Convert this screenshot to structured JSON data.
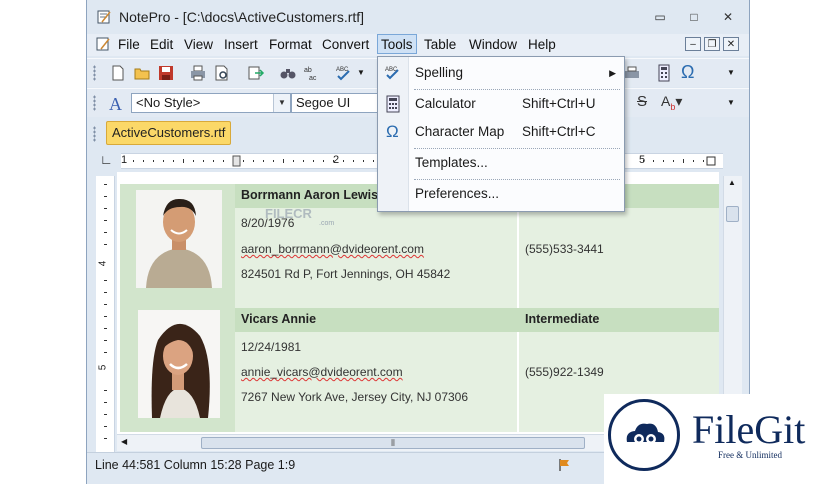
{
  "window": {
    "title": "NotePro - [C:\\docs\\ActiveCustomers.rtf]",
    "minimize_glyph": "▭",
    "maximize_glyph": "□",
    "close_glyph": "✕"
  },
  "menubar": {
    "items": [
      "File",
      "Edit",
      "View",
      "Insert",
      "Format",
      "Convert",
      "Tools",
      "Table",
      "Window",
      "Help"
    ],
    "active": "Tools"
  },
  "format_toolbar": {
    "style_value": "<No Style>",
    "font_value": "Segoe UI"
  },
  "document_tab": "ActiveCustomers.rtf",
  "ruler": {
    "marks": [
      "1",
      "2",
      "5"
    ]
  },
  "vruler": {
    "marks": [
      "4",
      "5"
    ]
  },
  "records": [
    {
      "name": "Borrmann Aaron Lewis",
      "level": "",
      "date": "8/20/1976",
      "email": "aaron_borrmann@dvideorent.com",
      "phone": "(555)533-3441",
      "address": "824501 Rd P, Fort Jennings, OH 45842"
    },
    {
      "name": "Vicars Annie",
      "level": "Intermediate",
      "date": "12/24/1981",
      "email": "annie_vicars@dvideorent.com",
      "phone": "(555)922-1349",
      "address": "7267 New York Ave, Jersey City, NJ 07306"
    }
  ],
  "tools_menu": {
    "items": [
      {
        "label": "Spelling",
        "shortcut": "",
        "icon": "spelling-icon",
        "submenu": true
      },
      {
        "label": "Calculator",
        "shortcut": "Shift+Ctrl+U",
        "icon": "calculator-icon"
      },
      {
        "label": "Character Map",
        "shortcut": "Shift+Ctrl+C",
        "icon": "omega-icon"
      },
      {
        "label": "Templates...",
        "shortcut": "",
        "icon": ""
      },
      {
        "label": "Preferences...",
        "shortcut": "",
        "icon": ""
      }
    ]
  },
  "statusbar": {
    "position": "Line 44:581  Column 15:28  Page 1:9"
  },
  "watermarks": {
    "filecr": "FILECR",
    "filecr_sub": ".com",
    "filegit_brand": "FileGit",
    "filegit_tag": "Free & Unlimited"
  },
  "colors": {
    "menu_highlight": "#cfe1f5",
    "tab_yellow": "#fbd868",
    "table_green": "#c7dfc0",
    "brand_navy": "#0f2a5c"
  }
}
